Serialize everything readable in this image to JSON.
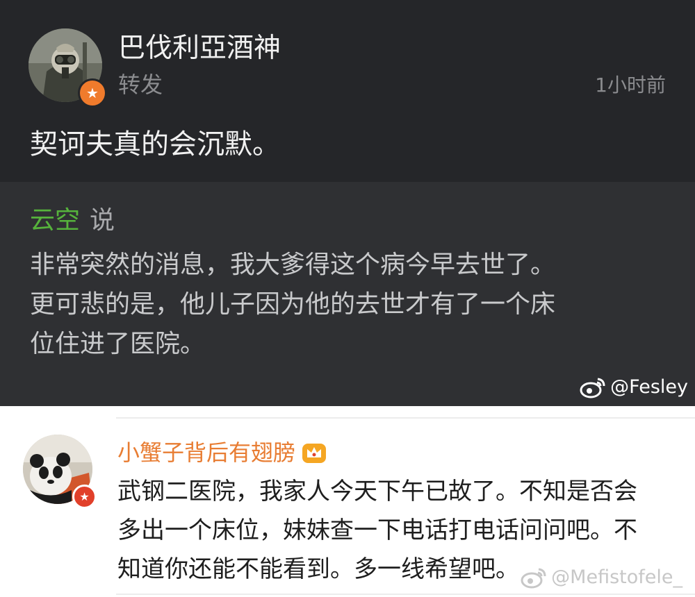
{
  "repost": {
    "username": "巴伐利亞酒神",
    "repost_label": "转发",
    "timestamp": "1小时前",
    "text": "契诃夫真的会沉默。",
    "badge_icon": "verified-badge-icon"
  },
  "quote": {
    "author": "云空",
    "said": "说",
    "lines": [
      "非常突然的消息，我大爹得这个病今早去世了。",
      "更可悲的是，他儿子因为他的去世才有了一个床",
      "位住进了医院。"
    ]
  },
  "watermark_top": "@Fesley",
  "comment": {
    "username": "小蟹子背后有翅膀",
    "badge_icon": "vip-crown-icon",
    "lines": [
      "武钢二医院，我家人今天下午已故了。不知是否会",
      "多出一个床位，妹妹查一下电话打电话问问吧。不",
      "知道你还能不能看到。多一线希望吧。"
    ]
  },
  "watermark_bottom": "@Mefistofele_",
  "colors": {
    "dark_bg": "#252629",
    "quote_bg": "#2f3033",
    "quote_author": "#56b33c",
    "comment_username": "#e87d33",
    "badge_orange": "#f07b2c"
  }
}
